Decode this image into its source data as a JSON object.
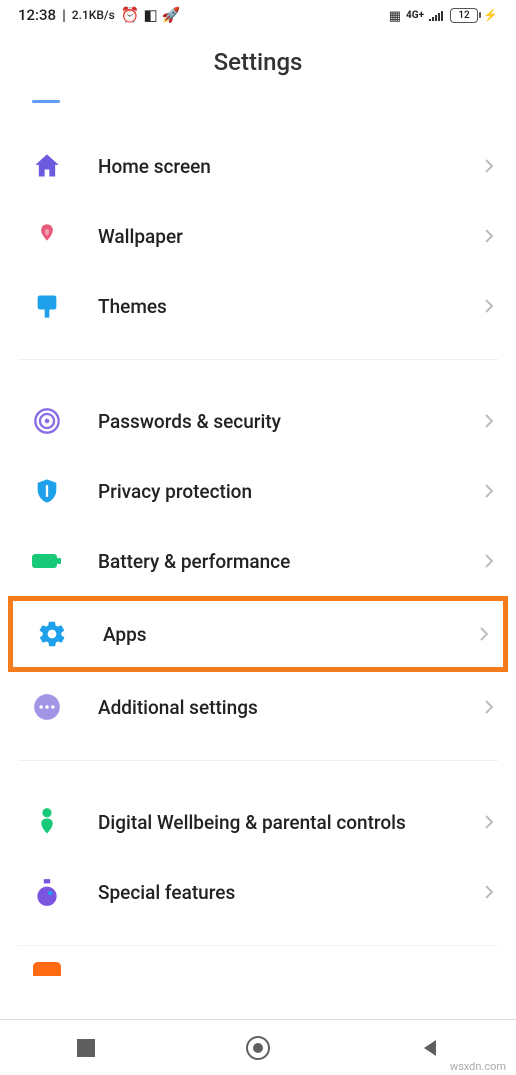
{
  "status": {
    "time": "12:38",
    "speed": "2.1KB/s",
    "battery_level": "12",
    "network": "4G+"
  },
  "header": {
    "title": "Settings"
  },
  "sections": [
    {
      "items": [
        {
          "id": "home-screen",
          "label": "Home screen",
          "icon": "home-icon",
          "color": "#6c5adf"
        },
        {
          "id": "wallpaper",
          "label": "Wallpaper",
          "icon": "tulip-icon",
          "color": "#e85a7a"
        },
        {
          "id": "themes",
          "label": "Themes",
          "icon": "brush-icon",
          "color": "#1ea0eb"
        }
      ]
    },
    {
      "items": [
        {
          "id": "passwords-security",
          "label": "Passwords & security",
          "icon": "fingerprint-icon",
          "color": "#8a6ce5"
        },
        {
          "id": "privacy-protection",
          "label": "Privacy protection",
          "icon": "shield-icon",
          "color": "#1ea0eb"
        },
        {
          "id": "battery-performance",
          "label": "Battery & performance",
          "icon": "battery-icon",
          "color": "#19c97a"
        },
        {
          "id": "apps",
          "label": "Apps",
          "icon": "gear-icon",
          "color": "#1ea0eb",
          "highlighted": true
        },
        {
          "id": "additional-settings",
          "label": "Additional settings",
          "icon": "dots-icon",
          "color": "#a395e6"
        }
      ]
    },
    {
      "items": [
        {
          "id": "digital-wellbeing",
          "label": "Digital Wellbeing & parental controls",
          "icon": "wellbeing-icon",
          "color": "#19c97a"
        },
        {
          "id": "special-features",
          "label": "Special features",
          "icon": "flask-icon",
          "color": "#7b54e0"
        }
      ]
    }
  ],
  "watermark": "wsxdn.com",
  "highlight_color": "#f57c1c"
}
